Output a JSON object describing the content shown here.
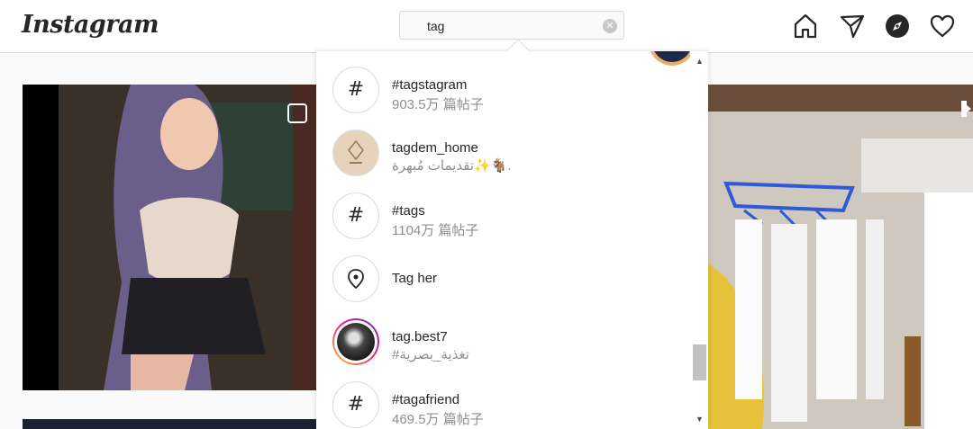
{
  "header": {
    "logo_text": "Instagram",
    "search": {
      "value": "tag",
      "clear_icon": "clear-icon"
    },
    "nav_icons": [
      "home-icon",
      "direct-icon",
      "explore-icon",
      "activity-icon"
    ]
  },
  "results": [
    {
      "type": "hashtag",
      "icon": "hashtag-icon",
      "title": "#tagstagram",
      "subtitle": "903.5万 篇帖子"
    },
    {
      "type": "user",
      "icon": "avatar",
      "title": "tagdem_home",
      "subtitle": "تقديمات مُبهرة✨🐐."
    },
    {
      "type": "hashtag",
      "icon": "hashtag-icon",
      "title": "#tags",
      "subtitle": "1104万 篇帖子"
    },
    {
      "type": "place",
      "icon": "location-pin-icon",
      "title": "Tag her",
      "subtitle": ""
    },
    {
      "type": "user-story",
      "icon": "avatar",
      "title": "tag.best7",
      "subtitle": "#تغذية_بصرية"
    },
    {
      "type": "hashtag",
      "icon": "hashtag-icon",
      "title": "#tagafriend",
      "subtitle": "469.5万 篇帖子"
    }
  ],
  "scrollbar": {
    "up_arrow": "▲",
    "down_arrow": "▼"
  },
  "colors": {
    "border": "#dbdbdb",
    "secondary_text": "#8e8e8e",
    "primary_text": "#262626"
  }
}
